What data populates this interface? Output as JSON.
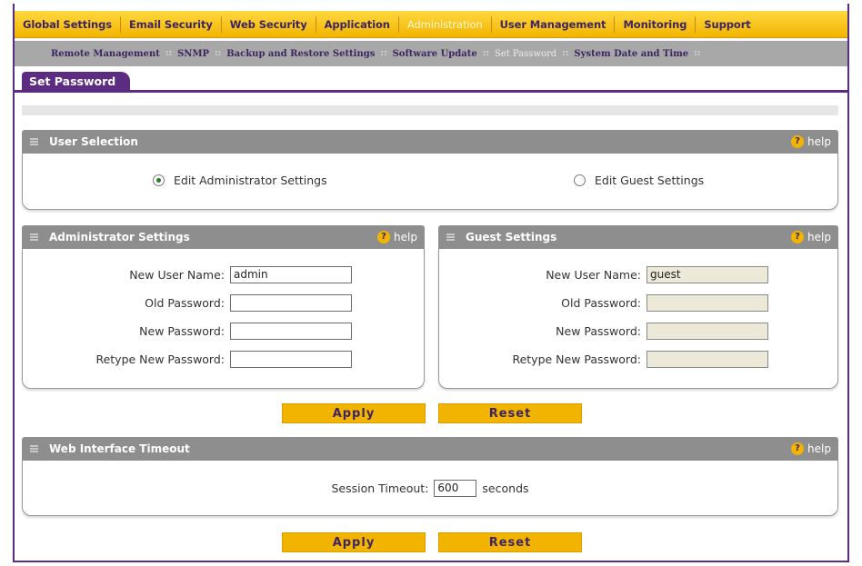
{
  "topnav": [
    {
      "label": "Global Settings",
      "active": false
    },
    {
      "label": "Email Security",
      "active": false
    },
    {
      "label": "Web Security",
      "active": false
    },
    {
      "label": "Application",
      "active": false
    },
    {
      "label": "Administration",
      "active": true
    },
    {
      "label": "User Management",
      "active": false
    },
    {
      "label": "Monitoring",
      "active": false
    },
    {
      "label": "Support",
      "active": false
    }
  ],
  "subnav": [
    {
      "label": "Remote Management",
      "active": false
    },
    {
      "label": "SNMP",
      "active": false
    },
    {
      "label": "Backup and Restore Settings",
      "active": false
    },
    {
      "label": "Software Update",
      "active": false
    },
    {
      "label": "Set Password",
      "active": true
    },
    {
      "label": "System Date and Time",
      "active": false
    }
  ],
  "page_tab": "Set Password",
  "help_label": "help",
  "user_selection": {
    "title": "User Selection",
    "admin_option": "Edit Administrator Settings",
    "guest_option": "Edit Guest Settings",
    "selected": "admin"
  },
  "admin_settings": {
    "title": "Administrator Settings",
    "fields": [
      {
        "label": "New User Name:",
        "value": "admin"
      },
      {
        "label": "Old Password:",
        "value": ""
      },
      {
        "label": "New Password:",
        "value": ""
      },
      {
        "label": "Retype New Password:",
        "value": ""
      }
    ]
  },
  "guest_settings": {
    "title": "Guest Settings",
    "fields": [
      {
        "label": "New User Name:",
        "value": "guest"
      },
      {
        "label": "Old Password:",
        "value": ""
      },
      {
        "label": "New Password:",
        "value": ""
      },
      {
        "label": "Retype New Password:",
        "value": ""
      }
    ]
  },
  "buttons": {
    "apply": "Apply",
    "reset": "Reset"
  },
  "timeout": {
    "title": "Web Interface Timeout",
    "label": "Session Timeout:",
    "value": "600",
    "unit": "seconds"
  },
  "colors": {
    "accent": "#f2b400",
    "brand": "#5b2c82",
    "header_gray": "#8e8e8e"
  }
}
